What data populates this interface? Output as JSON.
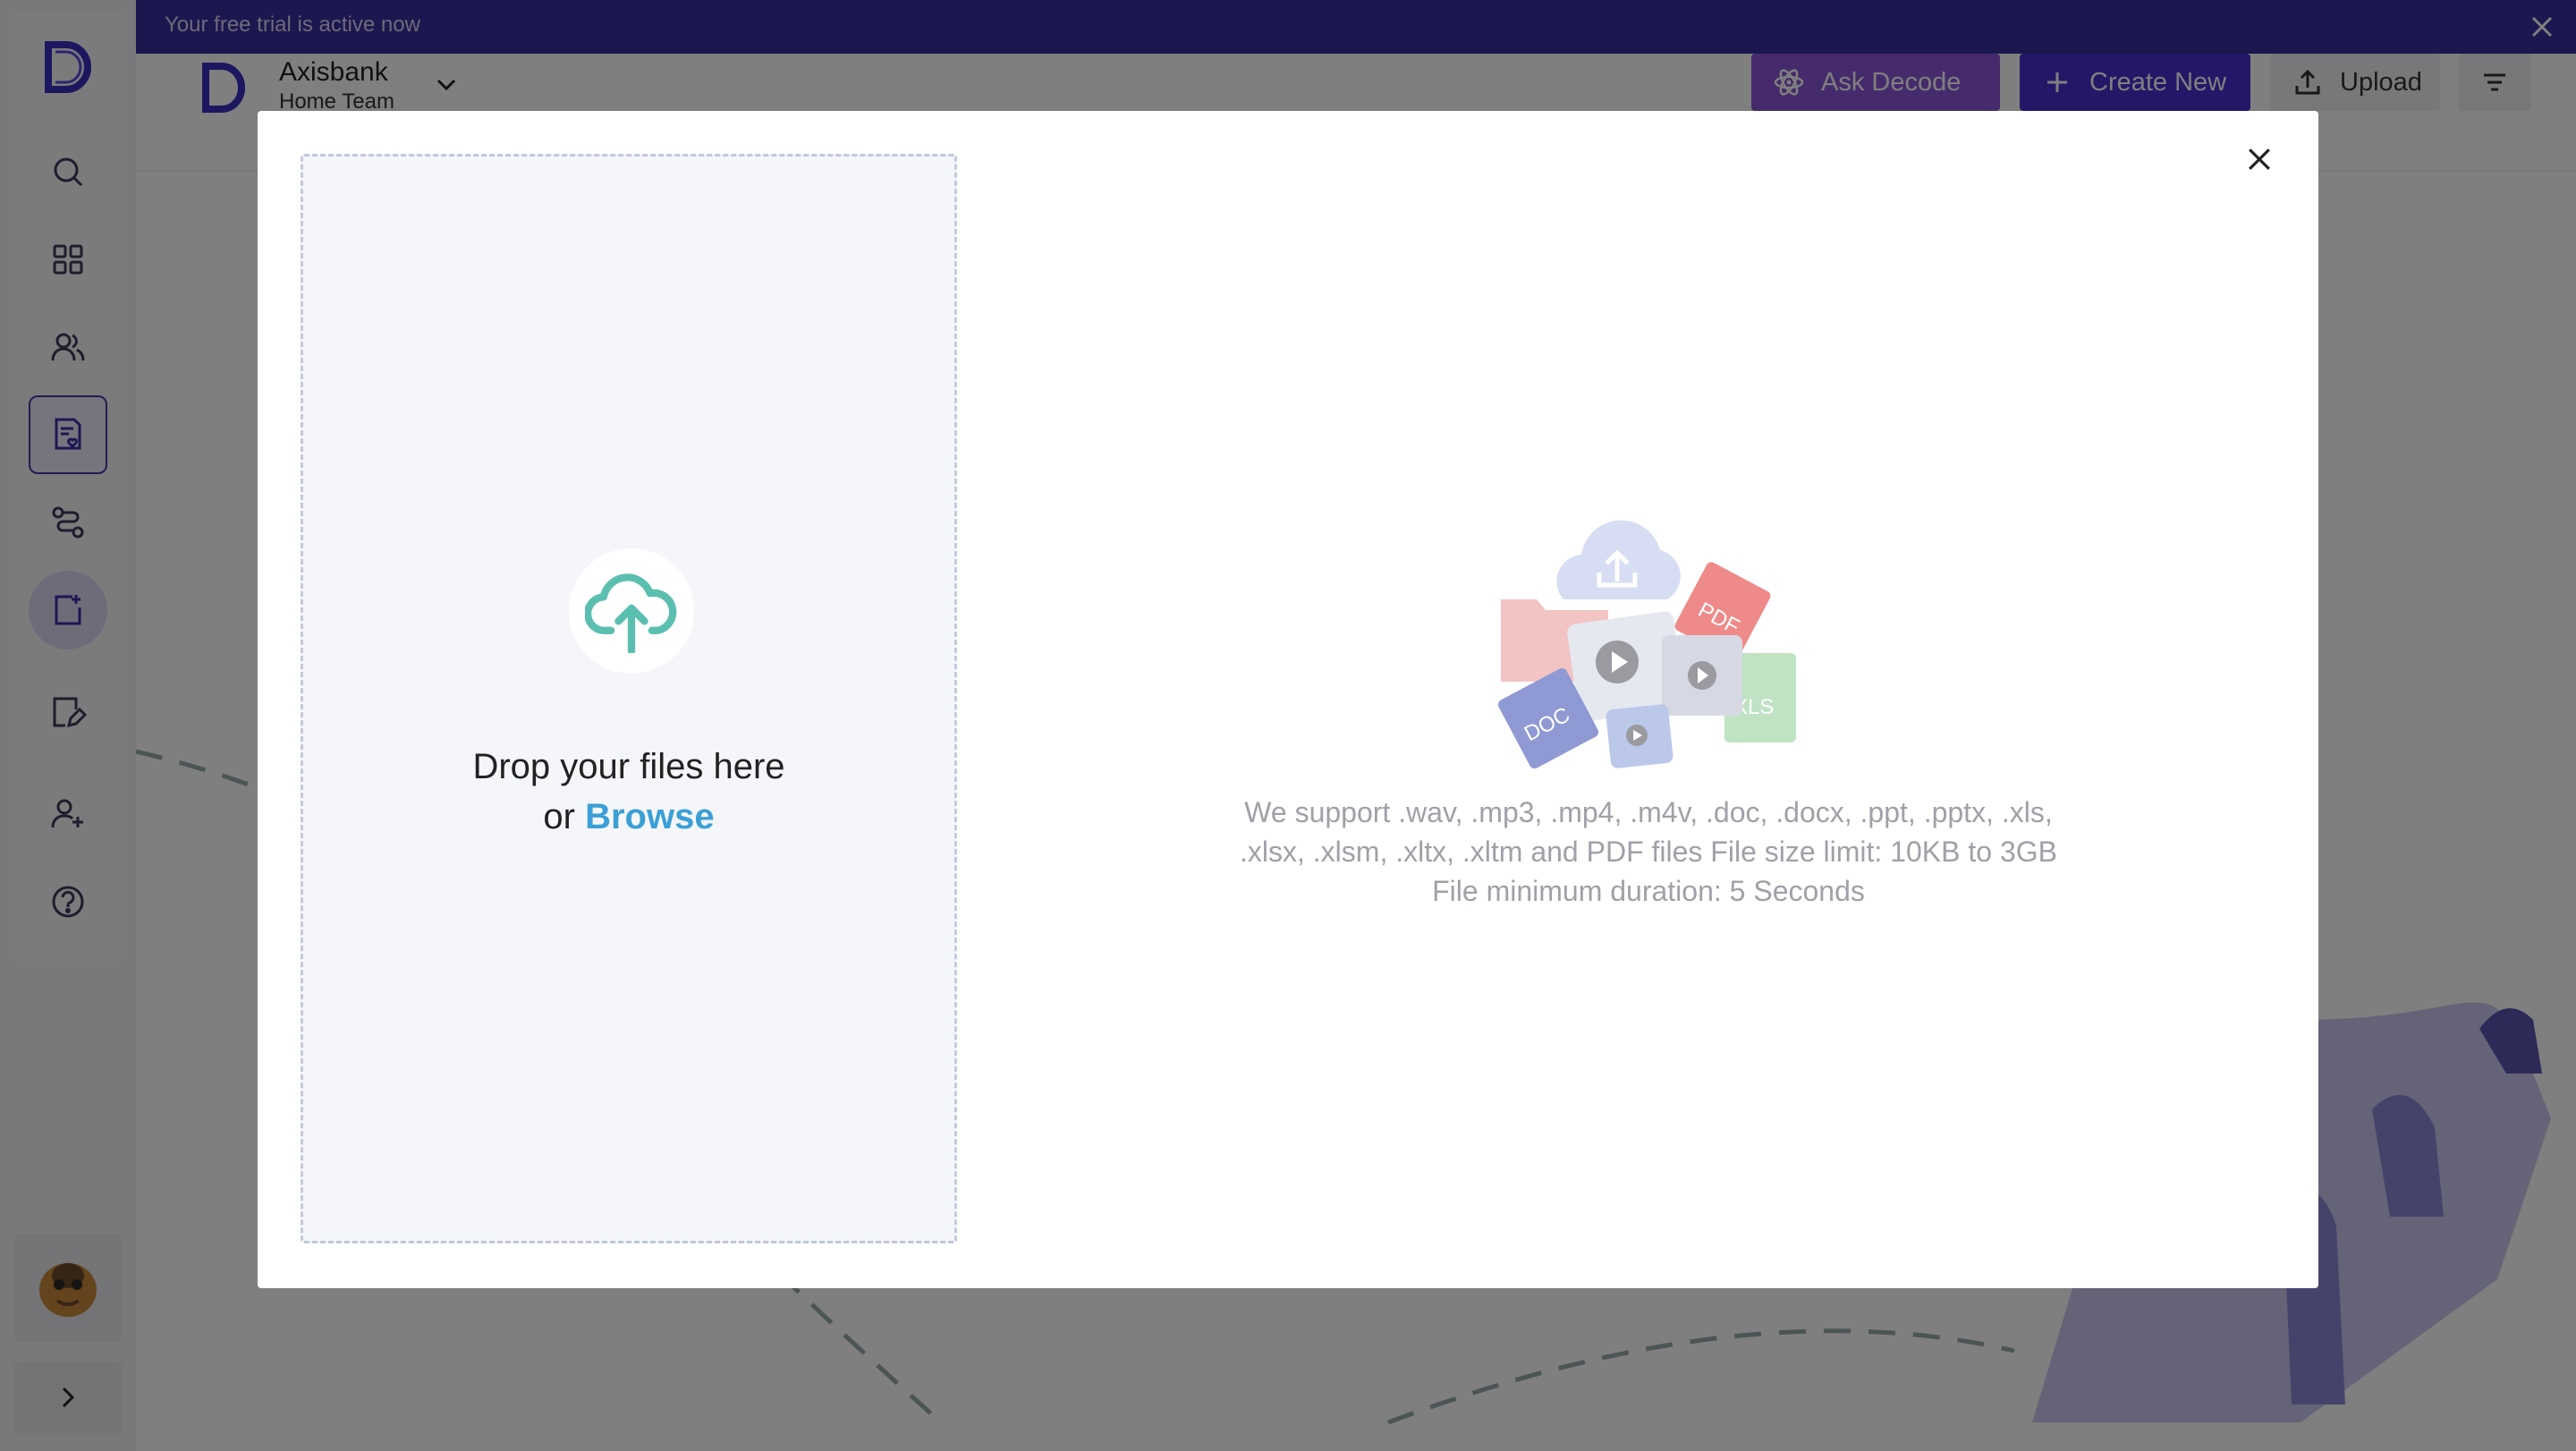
{
  "trial_banner": {
    "text": "Your free trial is active now"
  },
  "org": {
    "name": "Axisbank",
    "team": "Home Team"
  },
  "toolbar": {
    "ask_label": "Ask Decode",
    "create_label": "Create New",
    "upload_label": "Upload"
  },
  "sidebar": {
    "items": [
      {
        "icon": "search-icon"
      },
      {
        "icon": "grid-icon"
      },
      {
        "icon": "users-icon"
      },
      {
        "icon": "document-heart-icon",
        "active": true
      },
      {
        "icon": "flow-icon"
      },
      {
        "icon": "add-document-icon"
      },
      {
        "icon": "edit-document-icon"
      },
      {
        "icon": "add-user-icon"
      },
      {
        "icon": "help-icon"
      }
    ]
  },
  "upload_modal": {
    "drop_text": "Drop your files here",
    "or_text": "or",
    "browse_label": "Browse",
    "support_text": "We support .wav, .mp3, .mp4, .m4v, .doc, .docx, .ppt, .pptx, .xls, .xlsx, .xlsm, .xltx, .xltm and PDF files File size limit: 10KB to 3GB File minimum duration: 5 Seconds",
    "illustration_labels": {
      "pdf": "PDF",
      "doc": "DOC",
      "xls": "XLS"
    }
  },
  "colors": {
    "trial_bar": "#3b2f9e",
    "ask_button": "#8a57d8",
    "create_button": "#4a2fd1",
    "browse_link": "#3aa0d6",
    "upload_icon": "#5bbfb0"
  }
}
